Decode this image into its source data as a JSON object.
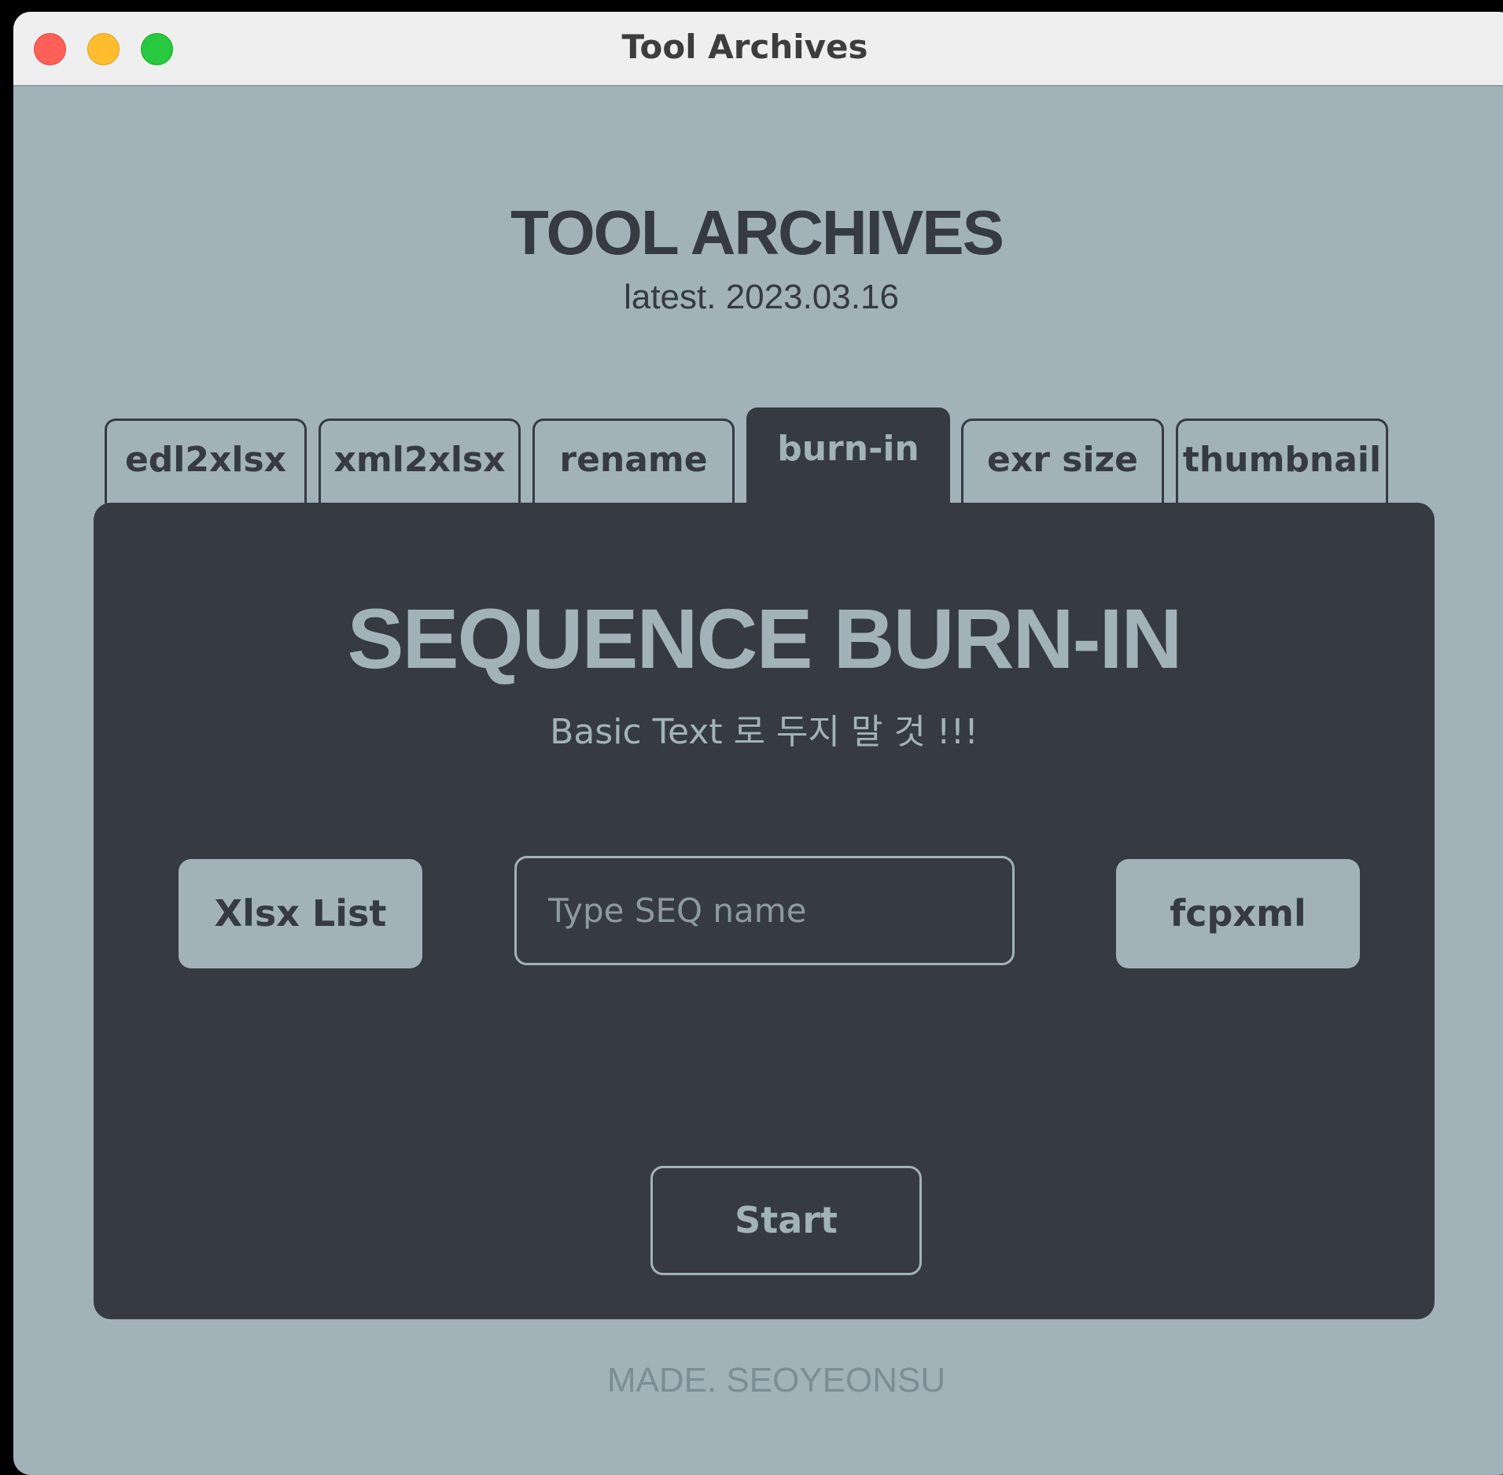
{
  "window": {
    "title": "Tool Archives",
    "controls": [
      "close",
      "minimize",
      "maximize"
    ]
  },
  "header": {
    "title": "TOOL ARCHIVES",
    "version": "latest. 2023.03.16"
  },
  "tabs": [
    {
      "label": "edl2xlsx",
      "active": false
    },
    {
      "label": "xml2xlsx",
      "active": false
    },
    {
      "label": "rename",
      "active": false
    },
    {
      "label": "burn-in",
      "active": true
    },
    {
      "label": "exr size",
      "active": false
    },
    {
      "label": "thumbnail",
      "active": false
    }
  ],
  "panel": {
    "title": "SEQUENCE BURN-IN",
    "subtitle": "Basic Text 로 두지 말 것 !!!",
    "xlsx_button": "Xlsx List",
    "seq_input": {
      "placeholder": "Type SEQ name",
      "value": ""
    },
    "fcpxml_button": "fcpxml",
    "start_button": "Start"
  },
  "footer": "MADE. SEOYEONSU",
  "colors": {
    "background": "#a1b3b9",
    "panel": "#363a42",
    "accent_text": "#a1b3b9",
    "footer_text": "#7c8e95"
  }
}
